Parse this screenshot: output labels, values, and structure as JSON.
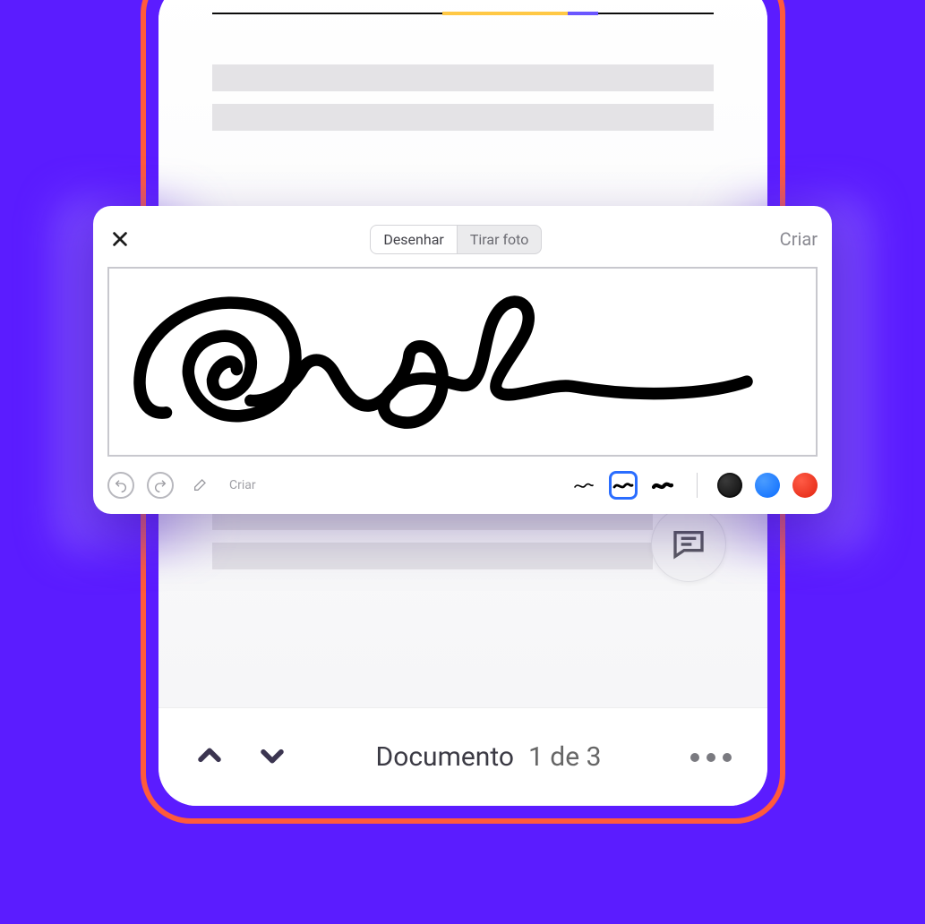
{
  "signature_modal": {
    "tabs": {
      "draw": "Desenhar",
      "photo": "Tirar foto"
    },
    "action_label": "Criar",
    "toolbar_label": "Criar",
    "icons": {
      "close": "close-icon",
      "undo": "undo-icon",
      "redo": "redo-icon",
      "eraser": "eraser-icon"
    },
    "thickness_options": [
      "thin",
      "medium",
      "thick"
    ],
    "selected_thickness": "medium",
    "colors": {
      "black": "#0a0a0a",
      "blue": "#0b6cff",
      "red": "#e22410"
    },
    "selected_color": "black"
  },
  "document_nav": {
    "label": "Documento",
    "position": "1 de 3"
  }
}
